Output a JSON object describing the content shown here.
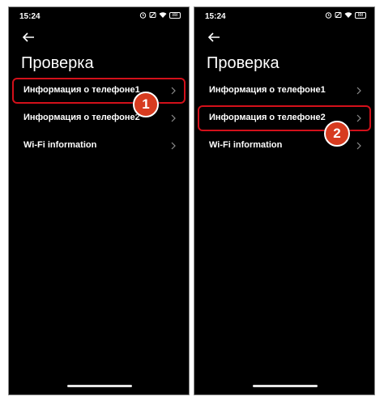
{
  "status": {
    "time": "15:24",
    "battery": "88"
  },
  "page": {
    "title": "Проверка"
  },
  "menu": {
    "items": [
      {
        "label": "Информация о телефоне1"
      },
      {
        "label": "Информация о телефоне2"
      },
      {
        "label": "Wi-Fi information"
      }
    ]
  },
  "callouts": {
    "step1": "1",
    "step2": "2"
  },
  "colors": {
    "highlight": "#d3101a",
    "badge": "#d73b1f",
    "background": "#000000"
  },
  "icons": {
    "back": "arrow-left-icon",
    "chevron": "chevron-right-icon"
  }
}
